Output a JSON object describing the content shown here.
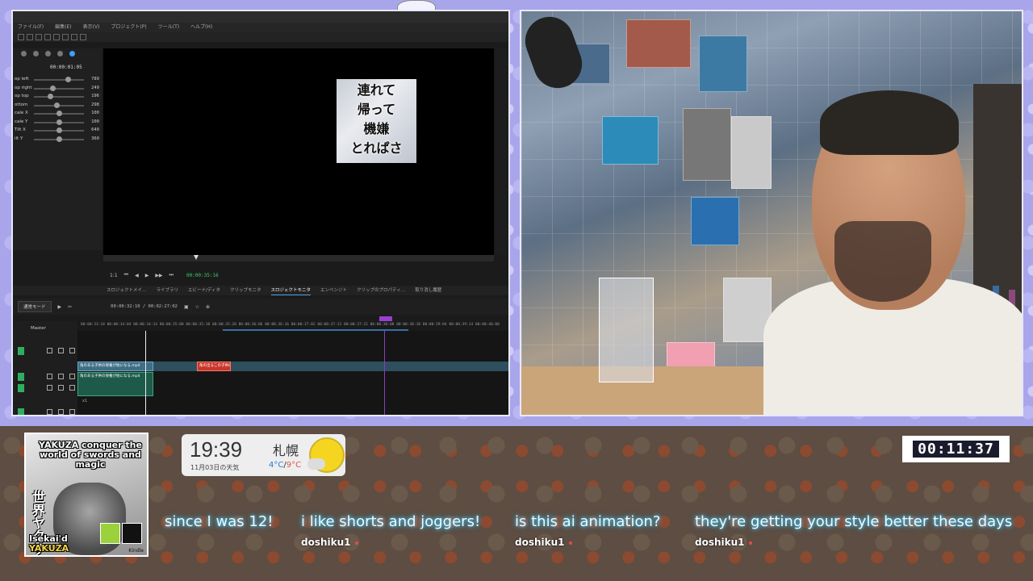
{
  "editor": {
    "left_panel": {
      "timecode": "00:00:01:05",
      "properties": [
        {
          "label": "op left",
          "value": "789",
          "knob": 0.7
        },
        {
          "label": "op right",
          "value": "249",
          "knob": 0.35
        },
        {
          "label": "op top",
          "value": "196",
          "knob": 0.3
        },
        {
          "label": "ottom",
          "value": "298",
          "knob": 0.45
        },
        {
          "label": "cale X",
          "value": "100",
          "knob": 0.5
        },
        {
          "label": "cale Y",
          "value": "100",
          "knob": 0.5
        },
        {
          "label": "Tilt X",
          "value": "640",
          "knob": 0.5
        },
        {
          "label": "ilt Y",
          "value": "360",
          "knob": 0.5
        }
      ]
    },
    "subtitle_lines": [
      "連れて",
      "帰って",
      "機嫌",
      "とれぱさ"
    ],
    "transport": {
      "timecode": "00:00:35:16",
      "zoom": "1:1"
    },
    "tabs": [
      "スロジェクトメイ…",
      "ライブラリ",
      "エビーナ/ディタ",
      "クリップモニタ",
      "スロジェクトモニタ",
      "エンベンジト",
      "クリップのプロパティ…",
      "取り消し履歴"
    ],
    "active_tab": "スロジェクトモニタ",
    "timeline": {
      "mode": "通常モード",
      "time": "00:00:32:10 / 00:02:27:02",
      "master_label": "Master",
      "ruler": [
        "00:00:33:18",
        "00:00:34:04",
        "00:00:34:14",
        "00:00:35:00",
        "00:00:35:10",
        "00:00:35:20",
        "00:00:36:06",
        "00:00:36:16",
        "00:00:37:02",
        "00:00:37:12",
        "00:00:37:22",
        "00:00:38:08",
        "00:00:38:18",
        "00:00:39:04",
        "00:00:39:14",
        "00:00:40:00"
      ],
      "clips": {
        "video": "角のある子供の保養が始になる.mp4",
        "audio": "角のある子供の保養が始になる.mp4",
        "red": "角の出るこの子供の"
      },
      "track_multiplier": "x1"
    }
  },
  "cover": {
    "title": "YAKUZA conquer the world of swords and magic",
    "kanji": "世界ヤクザ",
    "bottom_line1": "Isekai'd",
    "bottom_line2": "YAKUZA",
    "publisher": "Kindle"
  },
  "weather": {
    "time": "19:39",
    "date": "11月03日の天気",
    "city": "札幌",
    "temp_low": "4°C",
    "temp_sep": "/",
    "temp_high": "9°C"
  },
  "timer": "00:11:37",
  "chat": [
    {
      "text": "since I was 12!",
      "user": ""
    },
    {
      "text": "i like shorts and joggers!",
      "user": "doshiku1"
    },
    {
      "text": "is this ai animation?",
      "user": "doshiku1"
    },
    {
      "text": "they're getting your style better these days",
      "user": "doshiku1"
    }
  ],
  "colors": {
    "frame_bg": "#a9a5ea",
    "chat_glow": "#4fd6ff",
    "timer_bg": "#1b1b2e",
    "sun": "#f5d520"
  }
}
